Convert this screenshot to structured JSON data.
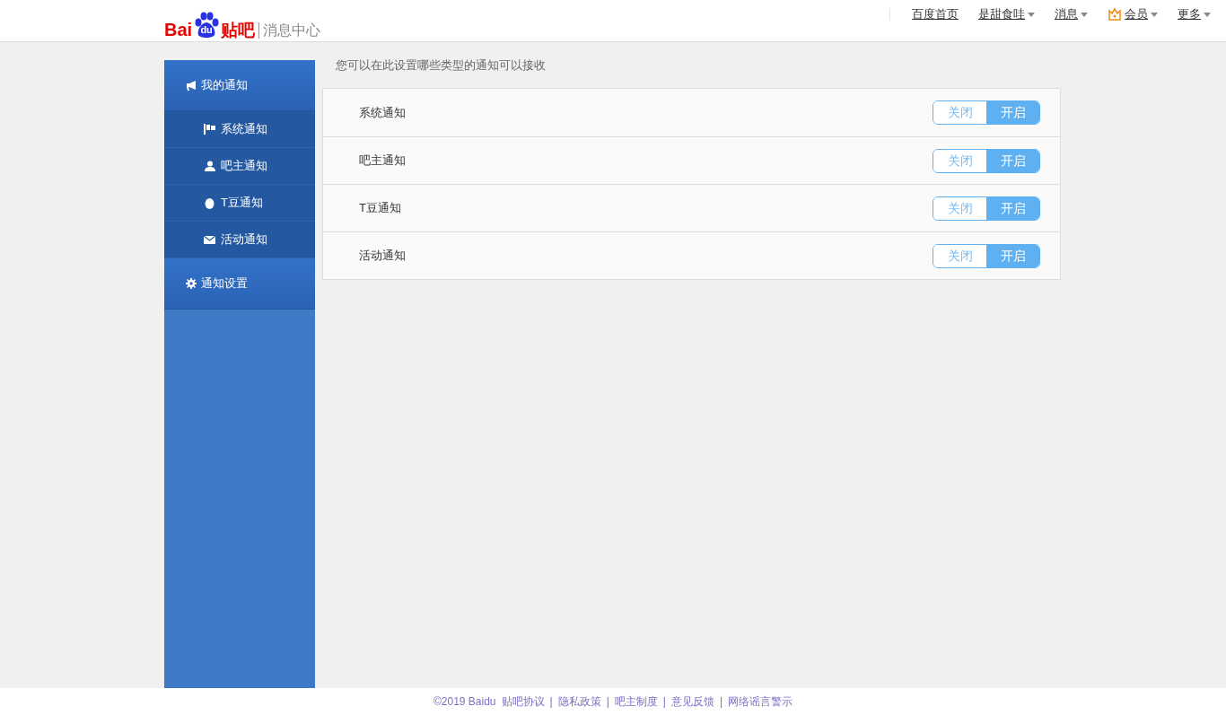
{
  "header": {
    "logo": {
      "prefix": "Bai",
      "paw_text": "du",
      "suffix": "贴吧"
    },
    "section": "消息中心",
    "nav": [
      {
        "label": "百度首页",
        "dropdown": false
      },
      {
        "label": "是甜食哇",
        "dropdown": true
      },
      {
        "label": "消息",
        "dropdown": true
      },
      {
        "label": "会员",
        "dropdown": true
      },
      {
        "label": "更多",
        "dropdown": true
      }
    ]
  },
  "sidebar": {
    "groups": [
      {
        "label": "我的通知",
        "children": [
          {
            "label": "系统通知"
          },
          {
            "label": "吧主通知"
          },
          {
            "label": "T豆通知"
          },
          {
            "label": "活动通知"
          }
        ]
      },
      {
        "label": "通知设置"
      }
    ]
  },
  "main": {
    "intro": "您可以在此设置哪些类型的通知可以接收",
    "settings": [
      {
        "label": "系统通知",
        "off_label": "关闭",
        "on_label": "开启",
        "on": true
      },
      {
        "label": "吧主通知",
        "off_label": "关闭",
        "on_label": "开启",
        "on": true
      },
      {
        "label": "T豆通知",
        "off_label": "关闭",
        "on_label": "开启",
        "on": true
      },
      {
        "label": "活动通知",
        "off_label": "关闭",
        "on_label": "开启",
        "on": true
      }
    ]
  },
  "footer": {
    "copyright": "©2019 Baidu",
    "links": [
      {
        "text": "贴吧协议"
      },
      {
        "text": "隐私政策",
        "separator": "|"
      },
      {
        "text": "吧主制度",
        "separator": "|"
      },
      {
        "text": "意见反馈",
        "separator": "|"
      },
      {
        "text": "网络谣言警示",
        "separator": "|"
      }
    ]
  }
}
